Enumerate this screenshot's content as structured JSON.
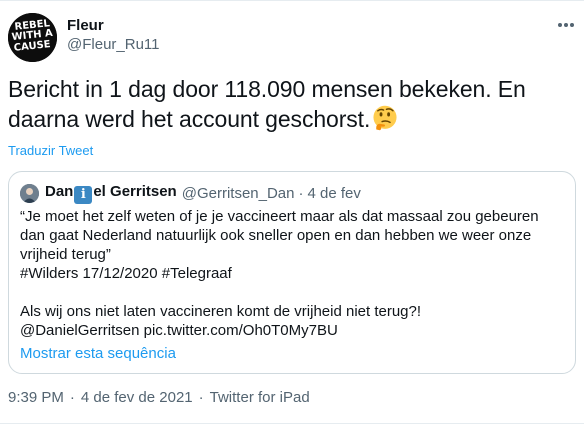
{
  "author": {
    "display_name": "Fleur",
    "handle": "@Fleur_Ru11",
    "avatar_text": "REBEL WITH A CAUSE"
  },
  "tweet": {
    "text": "Bericht in 1 dag door 118.090 mensen bekeken. En daarna werd het account geschorst.",
    "emoji": "thinking-face",
    "translate_label": "Traduzir Tweet"
  },
  "quoted_tweet": {
    "name_part1": "Dan",
    "name_badge": "i",
    "name_part2": "el Gerritsen",
    "handle": "@Gerritsen_Dan",
    "separator": "·",
    "date": "4 de fev",
    "lines": [
      "“Je moet het zelf weten of je je vaccineert maar als dat massaal zou gebeuren dan gaat Nederland natuurlijk ook sneller open en dan hebben we weer onze vrijheid terug”",
      "#Wilders 17/12/2020 #Telegraaf",
      "Als wij ons niet laten vaccineren komt de vrijheid niet terug?!",
      "@DanielGerritsen pic.twitter.com/Oh0T0My7BU"
    ],
    "show_thread_label": "Mostrar esta sequência"
  },
  "meta": {
    "time": "9:39 PM",
    "date": "4 de fev de 2021",
    "separator": "·",
    "source": "Twitter for iPad"
  },
  "colors": {
    "link": "#1d9bf0",
    "secondary_text": "#536471",
    "border": "#cfd9de",
    "badge": "#3b88c3"
  }
}
